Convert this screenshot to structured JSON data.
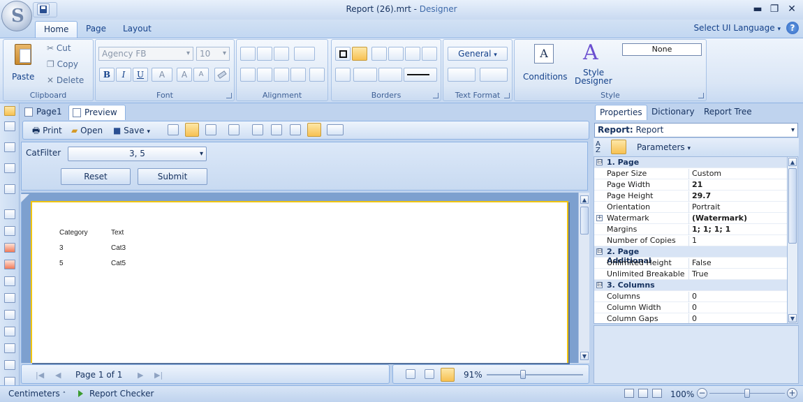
{
  "window": {
    "file_title": "Report (26).mrt",
    "title_separator": " - ",
    "app_name": "Designer",
    "minimize": "▬",
    "maximize": "❐",
    "close": "✕"
  },
  "ribbon": {
    "tabs": [
      {
        "label": "Home",
        "active": true
      },
      {
        "label": "Page",
        "active": false
      },
      {
        "label": "Layout",
        "active": false
      }
    ],
    "select_ui_language": "Select UI Language",
    "clipboard": {
      "label": "Clipboard",
      "paste": "Paste",
      "cut": "Cut",
      "copy": "Copy",
      "delete": "Delete"
    },
    "font": {
      "label": "Font",
      "family_value": "Agency FB",
      "size_value": "10",
      "bold": "B",
      "italic": "I",
      "underline": "U",
      "font_color": "A",
      "grow": "A",
      "shrink": "A"
    },
    "alignment": {
      "label": "Alignment"
    },
    "borders": {
      "label": "Borders"
    },
    "text_format": {
      "label": "Text Format",
      "format_value": "General"
    },
    "style": {
      "label": "Style",
      "conditions": "Conditions",
      "style_designer_line1": "Style",
      "style_designer_line2": "Designer",
      "style_value": "None"
    }
  },
  "document_tabs": [
    {
      "label": "Page1",
      "active": false
    },
    {
      "label": "Preview",
      "active": true
    }
  ],
  "preview_toolbar": {
    "print": "Print",
    "open": "Open",
    "save": "Save"
  },
  "parameters": {
    "catfilter_label": "CatFilter",
    "catfilter_value": "3, 5",
    "reset": "Reset",
    "submit": "Submit"
  },
  "report_table": {
    "headers": [
      "Category",
      "Text"
    ],
    "rows": [
      [
        "3",
        "Cat3"
      ],
      [
        "5",
        "Cat5"
      ]
    ]
  },
  "navigation": {
    "page_info": "Page 1 of 1",
    "zoom": "91%",
    "zoom_fraction": 0.38
  },
  "right_panel": {
    "tabs": [
      {
        "label": "Properties",
        "active": true
      },
      {
        "label": "Dictionary",
        "active": false
      },
      {
        "label": "Report Tree",
        "active": false
      }
    ],
    "object_type": "Report:",
    "object_name": "Report",
    "parameters_button": "Parameters",
    "properties": [
      {
        "type": "category",
        "expander": "⊟",
        "name": "1. Page"
      },
      {
        "type": "prop",
        "name": "Paper Size",
        "value": "Custom",
        "bold": false
      },
      {
        "type": "prop",
        "name": "Page Width",
        "value": "21",
        "bold": true
      },
      {
        "type": "prop",
        "name": "Page Height",
        "value": "29.7",
        "bold": true
      },
      {
        "type": "prop",
        "name": "Orientation",
        "value": "Portrait",
        "bold": false
      },
      {
        "type": "prop",
        "expander": "+",
        "name": "Watermark",
        "value": "(Watermark)",
        "bold": true
      },
      {
        "type": "prop",
        "name": "Margins",
        "value": "1; 1; 1; 1",
        "bold": true
      },
      {
        "type": "prop",
        "name": "Number of Copies",
        "value": "1",
        "bold": false
      },
      {
        "type": "category",
        "expander": "⊟",
        "name": "2. Page Additional"
      },
      {
        "type": "prop",
        "name": "Unlimited Height",
        "value": "False",
        "bold": false
      },
      {
        "type": "prop",
        "name": "Unlimited Breakable",
        "value": "True",
        "bold": false
      },
      {
        "type": "category",
        "expander": "⊟",
        "name": "3. Columns"
      },
      {
        "type": "prop",
        "name": "Columns",
        "value": "0",
        "bold": false
      },
      {
        "type": "prop",
        "name": "Column Width",
        "value": "0",
        "bold": false
      },
      {
        "type": "prop",
        "name": "Column Gaps",
        "value": "0",
        "bold": false
      }
    ]
  },
  "statusbar": {
    "units": "Centimeters",
    "report_checker": "Report Checker",
    "zoom": "100%"
  }
}
